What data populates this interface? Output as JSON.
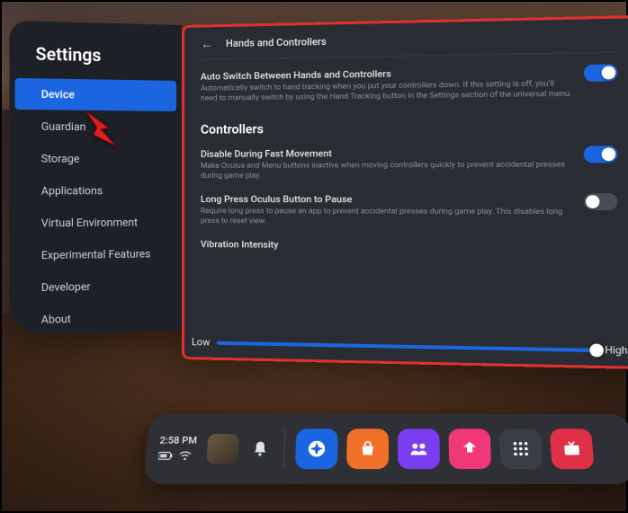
{
  "sidebar": {
    "title": "Settings",
    "items": [
      {
        "label": "Device",
        "active": true
      },
      {
        "label": "Guardian",
        "active": false
      },
      {
        "label": "Storage",
        "active": false
      },
      {
        "label": "Applications",
        "active": false
      },
      {
        "label": "Virtual Environment",
        "active": false
      },
      {
        "label": "Experimental Features",
        "active": false
      },
      {
        "label": "Developer",
        "active": false
      },
      {
        "label": "About",
        "active": false
      }
    ]
  },
  "panel": {
    "header": "Hands and Controllers",
    "settings": [
      {
        "title": "Auto Switch Between Hands and Controllers",
        "desc": "Automatically switch to hand tracking when you put your controllers down. If this setting is off, you'll need to manually switch by using the Hand Tracking button in the Settings section of the universal menu.",
        "on": true
      }
    ],
    "section": "Controllers",
    "controllerSettings": [
      {
        "title": "Disable During Fast Movement",
        "desc": "Make Oculus and Menu buttons inactive when moving controllers quickly to prevent accidental presses during game play.",
        "on": true
      },
      {
        "title": "Long Press Oculus Button to Pause",
        "desc": "Require long press to pause an app to prevent accidental presses during game play. This disables long press to reset view.",
        "on": false
      }
    ],
    "vibration": {
      "title": "Vibration Intensity",
      "low": "Low",
      "high": "High"
    }
  },
  "dock": {
    "clock": "2:58 PM",
    "battery_icon": "battery",
    "wifi_icon": "wifi",
    "notif_icon": "bell",
    "apps": [
      {
        "name": "explore",
        "color": "#1b66e0",
        "glyph": "✦"
      },
      {
        "name": "store",
        "color": "#f07028",
        "glyph": "shopping"
      },
      {
        "name": "people",
        "color": "#7a3df0",
        "glyph": "people"
      },
      {
        "name": "share",
        "color": "#f03878",
        "glyph": "share"
      },
      {
        "name": "apps",
        "color": "#3a3d46",
        "glyph": "grid"
      },
      {
        "name": "tv",
        "color": "#e03048",
        "glyph": "tv"
      }
    ]
  }
}
